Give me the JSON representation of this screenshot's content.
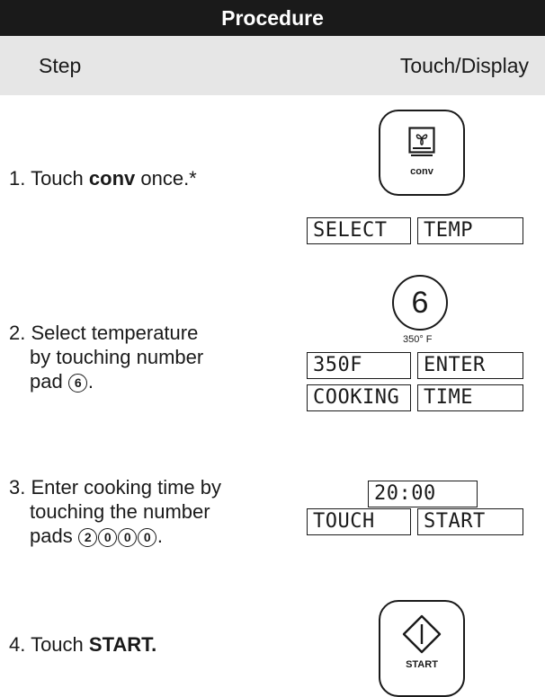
{
  "header": {
    "title": "Procedure"
  },
  "columns": {
    "step": "Step",
    "touch": "Touch/Display"
  },
  "steps": [
    {
      "prefix": "1. Touch ",
      "bold": "conv",
      "suffix": " once.*",
      "key": {
        "label": "conv",
        "icon": "convection-icon"
      },
      "display": [
        "SELECT",
        "TEMP"
      ]
    },
    {
      "line1": "2. Select temperature",
      "line2": "by touching number",
      "line3_prefix": "pad ",
      "line3_digit": "6",
      "line3_suffix": ".",
      "key": {
        "label": "6",
        "caption": "350° F"
      },
      "display": [
        "350F",
        "ENTER",
        "COOKING",
        "TIME"
      ]
    },
    {
      "line1": "3. Enter cooking time by",
      "line2": "touching the number",
      "line3_prefix": "pads ",
      "digits": [
        "2",
        "0",
        "0",
        "0"
      ],
      "line3_suffix": ".",
      "display": [
        "20:00",
        "TOUCH",
        "START"
      ]
    },
    {
      "prefix": "4. Touch ",
      "bold": "START.",
      "key": {
        "label": "START",
        "icon": "start-icon"
      }
    }
  ]
}
